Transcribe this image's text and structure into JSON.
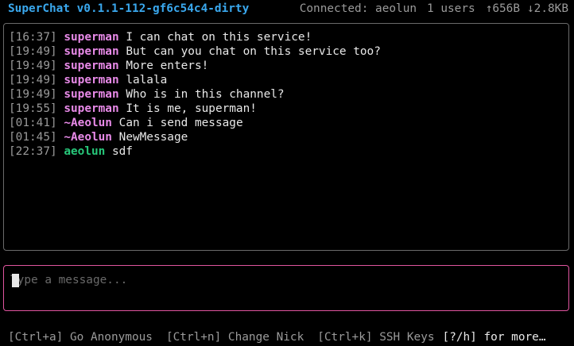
{
  "header": {
    "app_title": "SuperChat v0.1.1-112-gf6c54c4-dirty",
    "connection_status": "Connected: aeolun",
    "user_count": "1 users",
    "upload": "↑656B",
    "download": "↓2.8KB"
  },
  "messages": [
    {
      "time": "[16:37]",
      "nick": "superman",
      "text": "I can chat on this service!"
    },
    {
      "time": "[19:49]",
      "nick": "superman",
      "text": "But can you chat on this service too?"
    },
    {
      "time": "[19:49]",
      "nick": "superman",
      "text": "More enters!"
    },
    {
      "time": "[19:49]",
      "nick": "superman",
      "text": "lalala"
    },
    {
      "time": "[19:49]",
      "nick": "superman",
      "text": "Who is in this channel?"
    },
    {
      "time": "[19:55]",
      "nick": "superman",
      "text": "It is me, superman!"
    },
    {
      "time": "[01:41]",
      "nick": "~Aeolun",
      "text": "Can i send message"
    },
    {
      "time": "[01:45]",
      "nick": "~Aeolun",
      "text": "NewMessage"
    },
    {
      "time": "[22:37]",
      "nick": "aeolun",
      "text": "sdf"
    }
  ],
  "input": {
    "placeholder": "Type a message...",
    "value": ""
  },
  "help_bar": {
    "anonymous": "[Ctrl+a] Go Anonymous",
    "change_nick": "[Ctrl+n] Change Nick",
    "ssh_keys": "[Ctrl+k] SSH Keys",
    "more": "[?/h] for more…"
  },
  "colors": {
    "title": "#3aa8ee",
    "nick_other": "#e88ae8",
    "nick_self": "#27c77a",
    "input_border": "#e0559f",
    "panel_border": "#6a6a6a"
  }
}
